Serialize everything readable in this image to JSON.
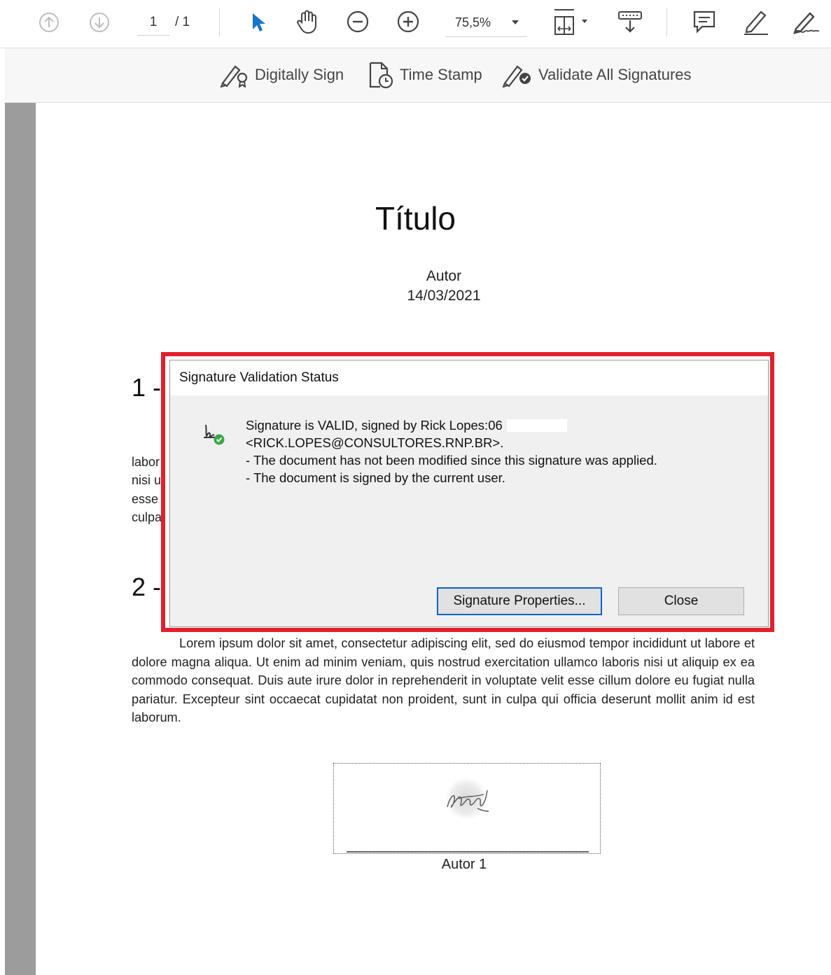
{
  "toolbar": {
    "page_current": "1",
    "page_total": "/ 1",
    "zoom": "75,5%"
  },
  "toolbar2": {
    "digitally_sign": "Digitally Sign",
    "time_stamp": "Time Stamp",
    "validate_all": "Validate All Signatures"
  },
  "document": {
    "title": "Título",
    "author": "Autor",
    "date": "14/03/2021",
    "section1": "1 -",
    "section2": "2 -",
    "hidden_fragments": [
      "labor",
      "nisi u",
      "esse",
      "culpa"
    ],
    "paragraph": "Lorem ipsum dolor sit amet, consectetur adipiscing elit, sed do eiusmod tempor incididunt ut labore et dolore magna aliqua. Ut enim ad minim veniam, quis nostrud exercitation ullamco laboris nisi ut aliquip ex ea commodo consequat. Duis aute irure dolor in reprehenderit in voluptate velit esse cillum dolore eu fugiat nulla pariatur. Excepteur sint occaecat cupidatat non proident, sunt in culpa qui officia deserunt mollit anim id est laborum.",
    "signature_caption": "Autor 1"
  },
  "dialog": {
    "title": "Signature Validation Status",
    "line1": "Signature is VALID, signed by Rick Lopes:06",
    "line2": "<RICK.LOPES@CONSULTORES.RNP.BR>.",
    "line3": "- The document has not been modified since this signature was applied.",
    "line4": "- The document is signed by the current user.",
    "btn_properties": "Signature Properties...",
    "btn_close": "Close"
  },
  "colors": {
    "accent_blue": "#1a73c8",
    "highlight_red": "#e0202e",
    "valid_green": "#3aa845"
  }
}
